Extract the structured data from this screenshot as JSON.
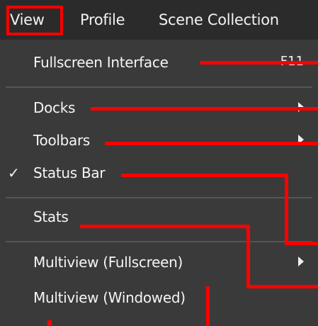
{
  "menubar": {
    "items": [
      {
        "label": "View"
      },
      {
        "label": "Profile"
      },
      {
        "label": "Scene Collection"
      }
    ]
  },
  "menu": {
    "fullscreen_interface": {
      "label": "Fullscreen Interface",
      "shortcut": "F11"
    },
    "docks": {
      "label": "Docks"
    },
    "toolbars": {
      "label": "Toolbars"
    },
    "status_bar": {
      "label": "Status Bar",
      "checked": true,
      "check_glyph": "✓"
    },
    "stats": {
      "label": "Stats"
    },
    "multiview_fullscreen": {
      "label": "Multiview (Fullscreen)"
    },
    "multiview_windowed": {
      "label": "Multiview (Windowed)"
    }
  },
  "colors": {
    "menu_background": "#3a3a3a",
    "menubar_background": "#2b2b2b",
    "annotation": "#ff0000",
    "text": "#f2f2f2"
  }
}
